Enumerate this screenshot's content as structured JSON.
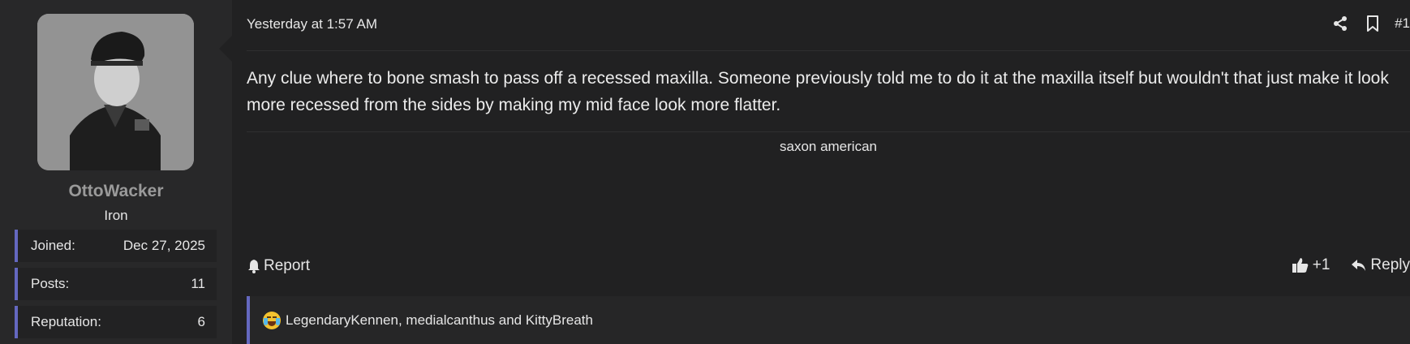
{
  "user": {
    "name": "OttoWacker",
    "rank": "Iron",
    "stats": [
      {
        "label": "Joined:",
        "value": "Dec 27, 2025"
      },
      {
        "label": "Posts:",
        "value": "11"
      },
      {
        "label": "Reputation:",
        "value": "6"
      }
    ]
  },
  "post": {
    "date": "Yesterday at 1:57 AM",
    "number": "#1",
    "body": "Any clue where to bone smash to pass off a recessed maxilla. Someone previously told me to do it at the maxilla itself but wouldn't that just make it look more recessed from the sides by making my mid face look more flatter.",
    "signature": "saxon american"
  },
  "footer": {
    "report_label": "Report",
    "like_label": "+1",
    "reply_label": "Reply"
  },
  "reactions": {
    "emoji": "tears-of-joy-icon",
    "text": "LegendaryKennen, medialcanthus and KittyBreath"
  },
  "colors": {
    "accent": "#6468c0",
    "background": "#212122",
    "sidebar": "#282829"
  }
}
